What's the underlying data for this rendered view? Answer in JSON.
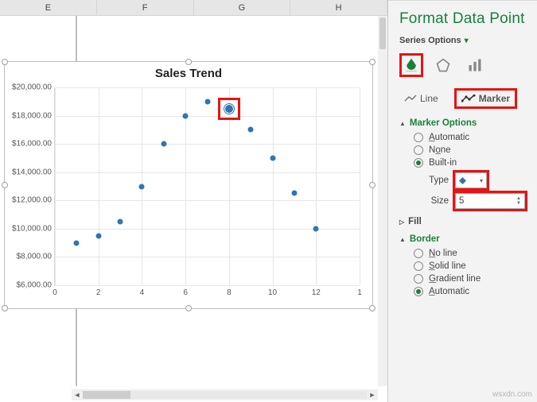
{
  "columns": [
    "E",
    "F",
    "G",
    "H"
  ],
  "chart_data": {
    "type": "scatter",
    "title": "Sales Trend",
    "xlabel": "",
    "ylabel": "",
    "xlim": [
      0,
      14
    ],
    "ylim": [
      6000,
      20000
    ],
    "yticks": [
      "$6,000.00",
      "$8,000.00",
      "$10,000.00",
      "$12,000.00",
      "$14,000.00",
      "$16,000.00",
      "$18,000.00",
      "$20,000.00"
    ],
    "xticks": [
      "0",
      "2",
      "4",
      "6",
      "8",
      "10",
      "12",
      "1"
    ],
    "data": [
      {
        "x": 1,
        "y": 9000
      },
      {
        "x": 2,
        "y": 9500
      },
      {
        "x": 3,
        "y": 10500
      },
      {
        "x": 4,
        "y": 13000
      },
      {
        "x": 5,
        "y": 16000
      },
      {
        "x": 6,
        "y": 18000
      },
      {
        "x": 7,
        "y": 19000
      },
      {
        "x": 8,
        "y": 18500
      },
      {
        "x": 9,
        "y": 17000
      },
      {
        "x": 10,
        "y": 15000
      },
      {
        "x": 11,
        "y": 12500
      },
      {
        "x": 12,
        "y": 10000
      }
    ],
    "selected_index": 7
  },
  "panel": {
    "title": "Format Data Point",
    "series_label": "Series Options",
    "tabs": {
      "line": "Line",
      "marker": "Marker"
    },
    "sections": {
      "marker_options": "Marker Options",
      "fill": "Fill",
      "border": "Border"
    },
    "marker_opts": {
      "automatic": "Automatic",
      "none": "None",
      "builtin": "Built-in",
      "type_label": "Type",
      "size_label": "Size",
      "size_value": "5"
    },
    "border_opts": {
      "noline": "No line",
      "solid": "Solid line",
      "gradient": "Gradient line",
      "automatic": "Automatic"
    }
  },
  "watermark": "wsxdn.com"
}
